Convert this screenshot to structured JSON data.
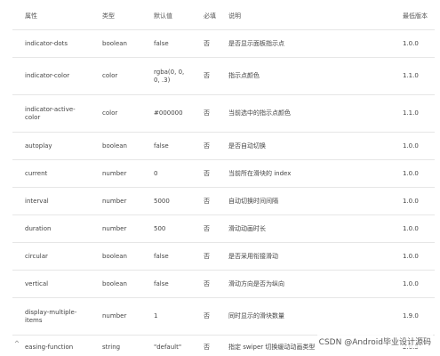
{
  "table": {
    "headers": {
      "attribute": "属性",
      "type": "类型",
      "default": "默认值",
      "required": "必填",
      "description": "说明",
      "min_version": "最低版本"
    },
    "rows": [
      {
        "attribute": "indicator-dots",
        "type": "boolean",
        "default": "false",
        "required": "否",
        "description": "是否显示面板指示点",
        "min_version": "1.0.0"
      },
      {
        "attribute": "indicator-color",
        "type": "color",
        "default": "rgba(0, 0, 0, .3)",
        "required": "否",
        "description": "指示点颜色",
        "min_version": "1.1.0"
      },
      {
        "attribute": "indicator-active-color",
        "type": "color",
        "default": "#000000",
        "required": "否",
        "description": "当前选中的指示点颜色",
        "min_version": "1.1.0"
      },
      {
        "attribute": "autoplay",
        "type": "boolean",
        "default": "false",
        "required": "否",
        "description": "是否自动切换",
        "min_version": "1.0.0"
      },
      {
        "attribute": "current",
        "type": "number",
        "default": "0",
        "required": "否",
        "description": "当前所在滑块的 index",
        "min_version": "1.0.0"
      },
      {
        "attribute": "interval",
        "type": "number",
        "default": "5000",
        "required": "否",
        "description": "自动切换时间间隔",
        "min_version": "1.0.0"
      },
      {
        "attribute": "duration",
        "type": "number",
        "default": "500",
        "required": "否",
        "description": "滑动动画时长",
        "min_version": "1.0.0"
      },
      {
        "attribute": "circular",
        "type": "boolean",
        "default": "false",
        "required": "否",
        "description": "是否采用衔接滑动",
        "min_version": "1.0.0"
      },
      {
        "attribute": "vertical",
        "type": "boolean",
        "default": "false",
        "required": "否",
        "description": "滑动方向是否为纵向",
        "min_version": "1.0.0"
      },
      {
        "attribute": "display-multiple-items",
        "type": "number",
        "default": "1",
        "required": "否",
        "description": "同时显示的滑块数量",
        "min_version": "1.9.0"
      },
      {
        "attribute": "easing-function",
        "type": "string",
        "default": "\"default\"",
        "required": "否",
        "description": "指定 swiper 切换缓动动画类型",
        "min_version": "2.6.5"
      }
    ]
  },
  "watermark": "CSDN @Android毕业设计源码",
  "icons": {
    "expand": "chevron-up-icon"
  }
}
